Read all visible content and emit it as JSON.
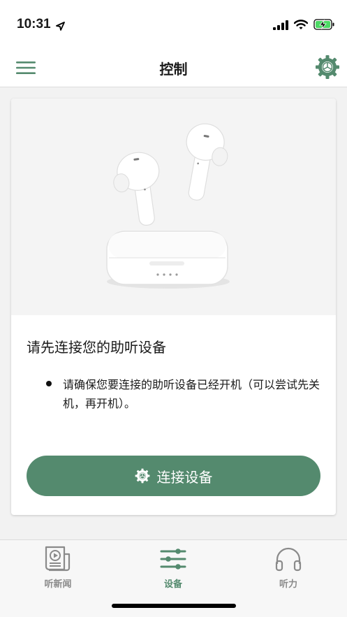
{
  "status_bar": {
    "time": "10:31",
    "location_icon": "location-arrow-icon",
    "signal_icon": "cellular-signal-icon",
    "wifi_icon": "wifi-icon",
    "battery_icon": "battery-charging-icon"
  },
  "header": {
    "title": "控制",
    "menu_icon": "hamburger-menu-icon",
    "settings_icon": "gear-icon"
  },
  "card": {
    "image": "wireless-earbuds-with-charging-case",
    "heading": "请先连接您的助听设备",
    "bullets": [
      "请确保您要连接的助听设备已经开机（可以尝试先关机，再开机）。"
    ],
    "connect_button": {
      "label": "连接设备",
      "icon": "gear-icon"
    }
  },
  "tab_bar": {
    "tabs": [
      {
        "label": "听新闻",
        "icon": "news-player-icon",
        "active": false
      },
      {
        "label": "设备",
        "icon": "sliders-icon",
        "active": true
      },
      {
        "label": "听力",
        "icon": "headphones-icon",
        "active": false
      }
    ]
  },
  "colors": {
    "accent": "#548a6e",
    "inactive": "#8a8a8a",
    "background": "#f2f2f2"
  }
}
